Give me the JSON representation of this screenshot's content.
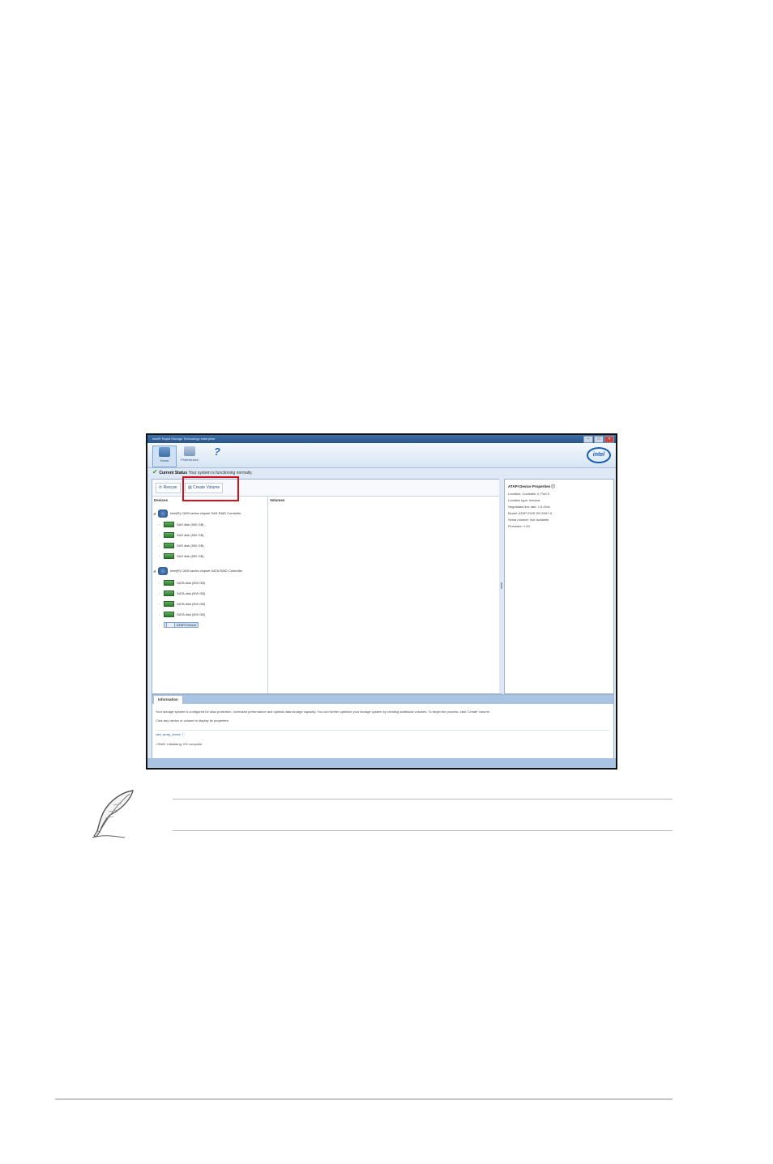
{
  "window": {
    "title": "Intel® Rapid Storage Technology enterprise",
    "controls": [
      "–",
      "□",
      "×"
    ]
  },
  "toolbar": {
    "home_label": "Home",
    "preferences_label": "Preferences",
    "help_label": "?",
    "intel_logo": "intel"
  },
  "status": {
    "heading": "Current Status",
    "text": "Your system is functioning normally."
  },
  "actions": {
    "rescan_label": "Rescan",
    "create_volume_label": "Create Volume"
  },
  "devices": {
    "header": "Devices",
    "controllers": [
      {
        "name": "Intel(R) C600 series chipset SAS RAID Controller",
        "disks": [
          "SAS disk (500 GB)",
          "SAS disk (500 GB)",
          "SAS disk (500 GB)",
          "SAS disk (500 GB)"
        ]
      },
      {
        "name": "Intel(R) C600 series chipset SATA RAID Controller",
        "disks": [
          "SATA disk (500 GB)",
          "SATA disk (500 GB)",
          "SATA disk (500 GB)",
          "SATA disk (500 GB)"
        ]
      }
    ],
    "atapi_device": "ATAPI Device"
  },
  "volumes": {
    "header": "Volumes"
  },
  "properties": {
    "title": "ATAPI Device Properties",
    "rows": [
      "Location: Controller 0, Port 5",
      "Location type: Internal",
      "Negotiated link rate: 1.5 Gb/s",
      "Model: ATAPI  DVD DD 8X8?  A",
      "Serial number: Not available",
      "Firmware: 1.00"
    ]
  },
  "info": {
    "tab_label": "Information",
    "line1": "Your storage system is configured for data protection, increased performance and optimal data storage capacity. You can further optimize your storage system by creating additional volumes. To begin the process, click 'Create Volume'.",
    "line2": "Click any device or volume to display its properties.",
    "report_label": "raid_array_check",
    "report_line": "• RAID:  Initializing, 0% complete"
  },
  "colors": {
    "highlight": "#d4111a",
    "accent": "#3d6fa8",
    "intel_blue": "#1a5eb0"
  },
  "icons": {
    "note": "quill-pen-icon",
    "controller": "controller-icon",
    "disk": "disk-icon",
    "status": "checkmark-icon"
  }
}
